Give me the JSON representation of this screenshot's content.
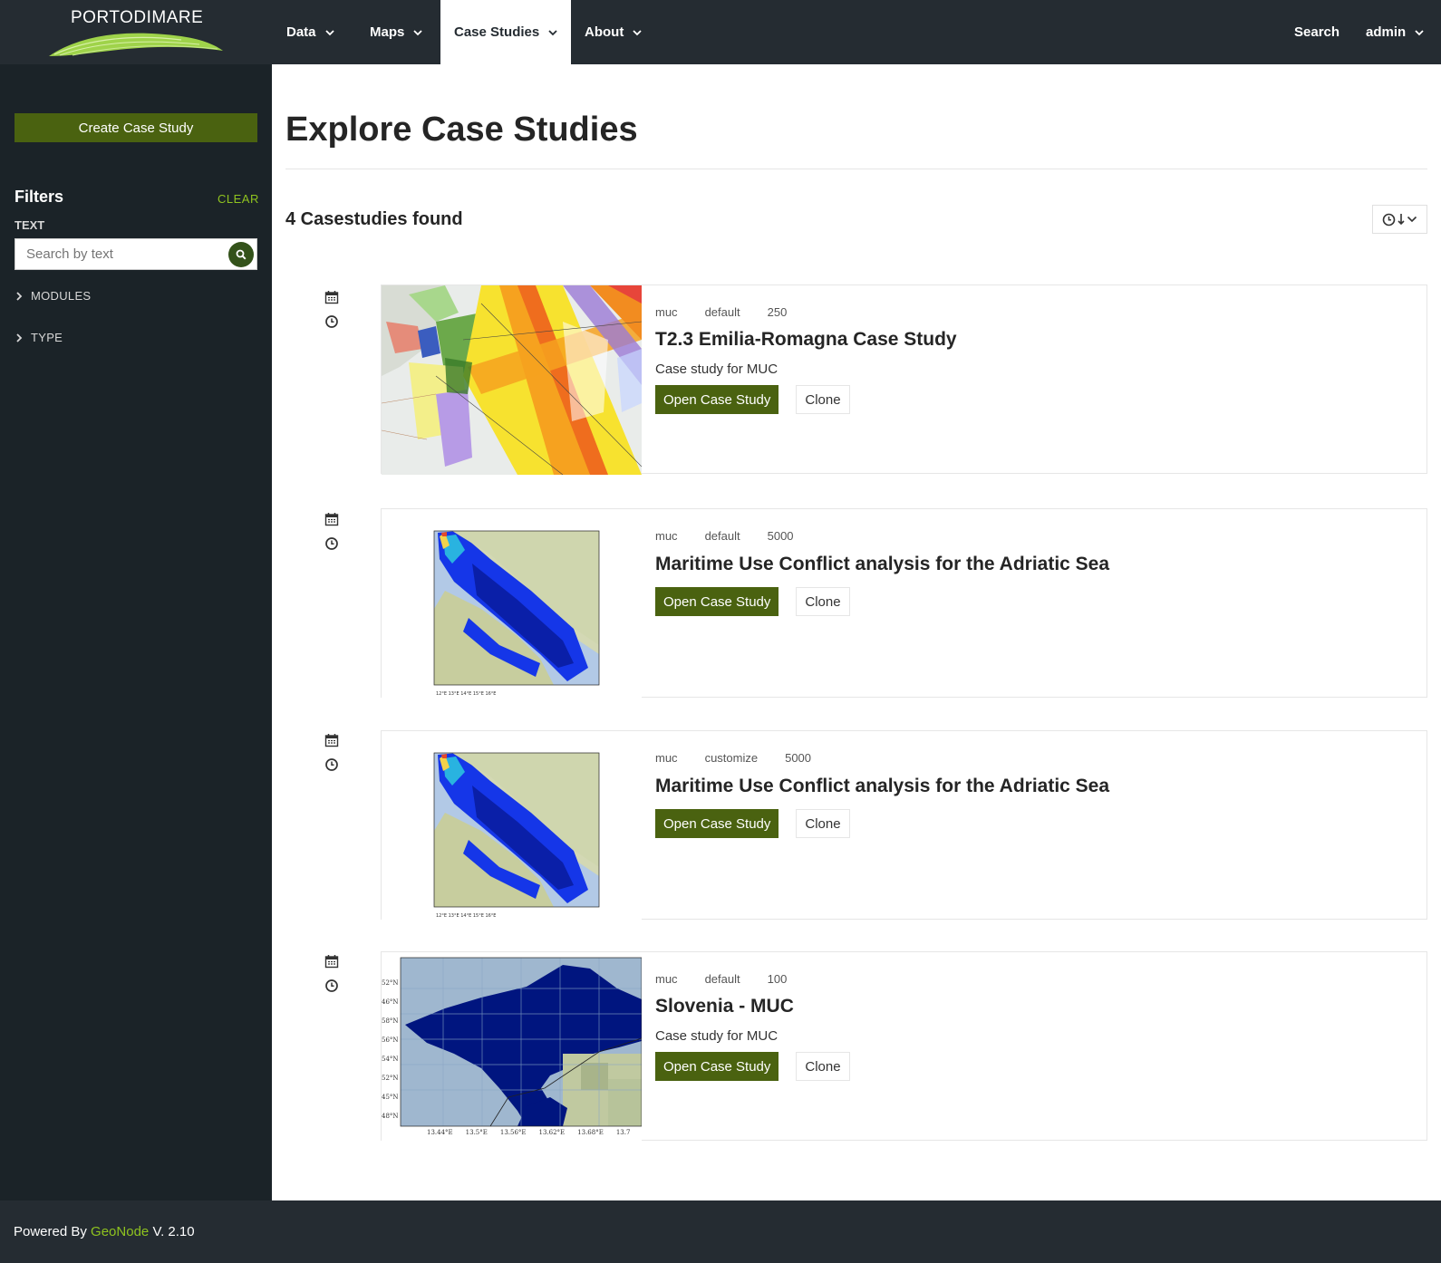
{
  "header": {
    "logo_text": "PORTODIMARE",
    "nav": [
      {
        "label": "Data"
      },
      {
        "label": "Maps"
      },
      {
        "label": "Case Studies"
      },
      {
        "label": "About"
      }
    ],
    "search_label": "Search",
    "user_label": "admin"
  },
  "sidebar": {
    "create_label": "Create Case Study",
    "filters_title": "Filters",
    "clear_label": "CLEAR",
    "text_label": "TEXT",
    "search_placeholder": "Search by text",
    "groups": [
      {
        "label": "MODULES"
      },
      {
        "label": "TYPE"
      }
    ]
  },
  "main": {
    "title": "Explore Case Studies",
    "found_text": "4 Casestudies found",
    "cards": [
      {
        "tags": [
          "muc",
          "default",
          "250"
        ],
        "title": "T2.3 Emilia-Romagna Case Study",
        "description": "Case study for MUC",
        "open_label": "Open Case Study",
        "clone_label": "Clone"
      },
      {
        "tags": [
          "muc",
          "default",
          "5000"
        ],
        "title": "Maritime Use Conflict analysis for the Adriatic Sea",
        "description": "",
        "open_label": "Open Case Study",
        "clone_label": "Clone"
      },
      {
        "tags": [
          "muc",
          "customize",
          "5000"
        ],
        "title": "Maritime Use Conflict analysis for the Adriatic Sea",
        "description": "",
        "open_label": "Open Case Study",
        "clone_label": "Clone"
      },
      {
        "tags": [
          "muc",
          "default",
          "100"
        ],
        "title": "Slovenia - MUC",
        "description": "Case study for MUC",
        "open_label": "Open Case Study",
        "clone_label": "Clone"
      }
    ],
    "slovenia_axis": {
      "lat_ticks": [
        "52°N",
        "46°N",
        "58°N",
        "56°N",
        "54°N",
        "52°N",
        "45°N",
        "48°N"
      ],
      "lon_ticks": [
        "13.44°E",
        "13.5°E",
        "13.56°E",
        "13.62°E",
        "13.68°E",
        "13.7"
      ]
    }
  },
  "footer": {
    "prefix": "Powered By",
    "link": "GeoNode",
    "version": "V. 2.10"
  },
  "colors": {
    "navbar": "#252c32",
    "sidebar": "#1b2328",
    "accent_green": "#4a6210",
    "link_green": "#8fc31f"
  }
}
